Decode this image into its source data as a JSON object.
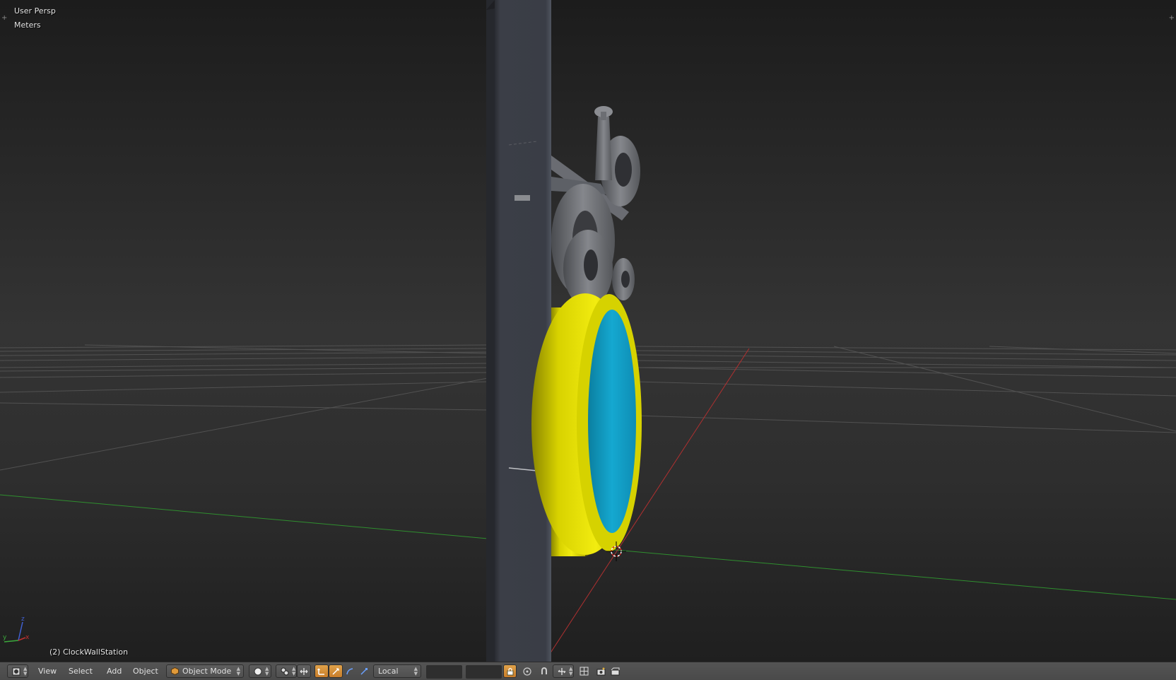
{
  "viewport": {
    "view_name": "User Persp",
    "units": "Meters",
    "active_object": "(2) ClockWallStation"
  },
  "colors": {
    "background_top": "#1c1c1c",
    "background_mid": "#343434",
    "grid_line": "#5a5a5a",
    "x_axis": "#b03030",
    "y_axis": "#2f8f2f",
    "post": "#3a3d45",
    "bracket": "#6b6d72",
    "clock_rim": "#e8e000",
    "clock_face": "#13a4cc",
    "header_bg": "#4f4f4f",
    "accent_orange": "#e0902a"
  },
  "header": {
    "editor_type_icon": "3d-view-icon",
    "menus": [
      "View",
      "Select",
      "Add",
      "Object"
    ],
    "mode_icon": "object-cube-icon",
    "mode": "Object Mode",
    "shading_icon": "solid-sphere-icon",
    "pivot_icon": "pivot-icon",
    "manipulator_icons": [
      "manipulator-icon",
      "translate-icon",
      "rotate-icon",
      "scale-icon"
    ],
    "orientation": "Local",
    "layers_row1": [
      true,
      false,
      false,
      false,
      false
    ],
    "layers_row2": [
      false,
      false,
      false,
      false,
      false
    ],
    "layers2_row1": [
      false,
      false,
      false,
      false,
      false
    ],
    "layers2_row2": [
      false,
      false,
      false,
      false,
      false
    ],
    "tool_icons": [
      "lock-icon",
      "proportional-icon",
      "snap-magnet-icon",
      "snap-element-icon",
      "snap-target-icon",
      "render-icon",
      "opengl-render-icon"
    ]
  }
}
